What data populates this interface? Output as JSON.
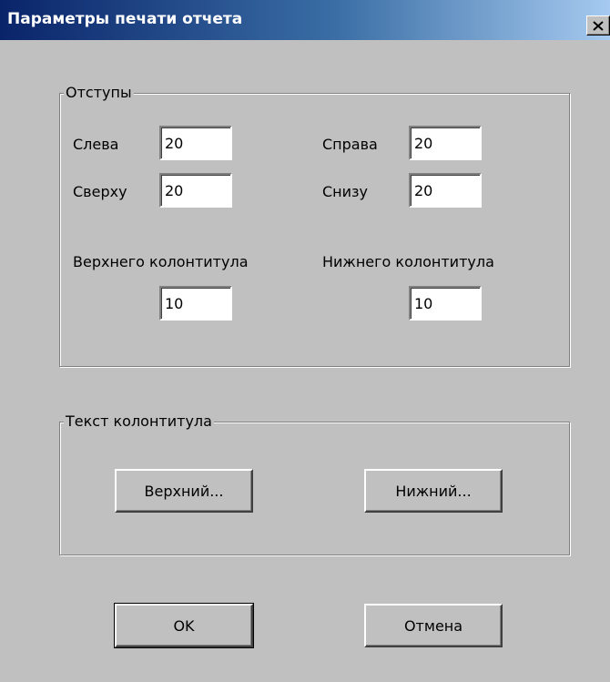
{
  "window": {
    "title": "Параметры печати отчета",
    "close_glyph": "✕",
    "close_icon": "close-icon"
  },
  "margins_group": {
    "legend": "Отступы",
    "left_label": "Слева",
    "left_value": "20",
    "right_label": "Справа",
    "right_value": "20",
    "top_label": "Сверху",
    "top_value": "20",
    "bottom_label": "Снизу",
    "bottom_value": "20",
    "header_label": "Верхнего колонтитула",
    "header_value": "10",
    "footer_label": "Нижнего колонтитула",
    "footer_value": "10"
  },
  "header_text_group": {
    "legend": "Текст колонтитула",
    "header_button": "Верхний...",
    "footer_button": "Нижний..."
  },
  "actions": {
    "ok": "OK",
    "cancel": "Отмена"
  }
}
